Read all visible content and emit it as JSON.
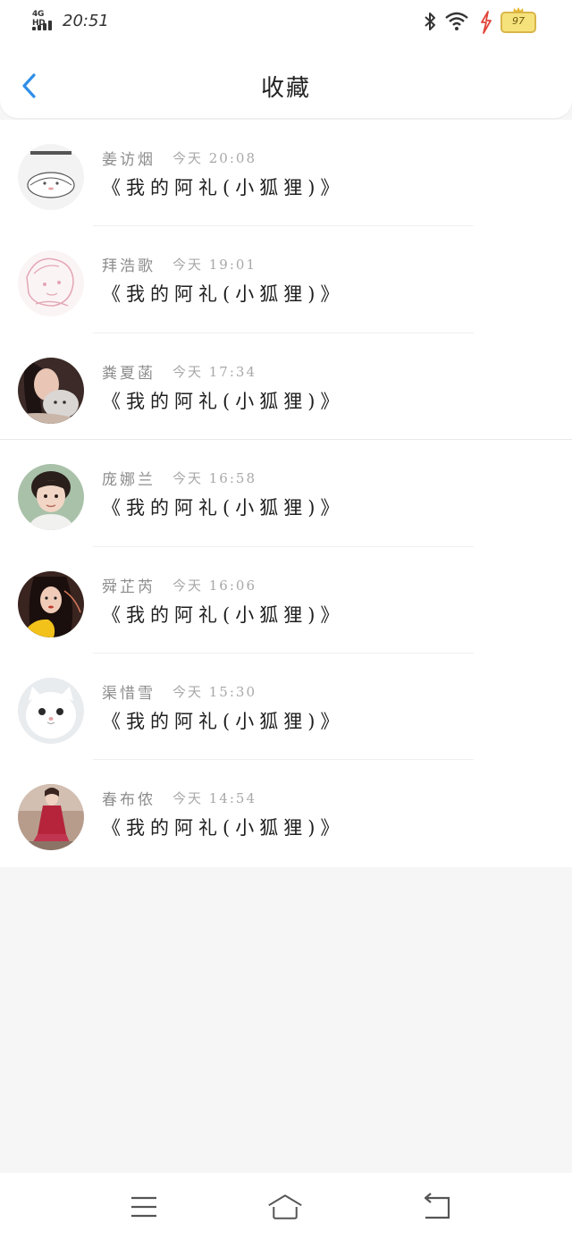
{
  "status_bar": {
    "network": "4G HD",
    "time": "20:51",
    "battery": "97",
    "icons": [
      "bluetooth-icon",
      "wifi-icon",
      "charging-icon",
      "battery-icon"
    ]
  },
  "header": {
    "title": "收藏",
    "back_icon": "chevron-left-icon",
    "accent_color": "#2f8fe8"
  },
  "favorites": [
    {
      "name": "姜访烟",
      "time": "今天 20:08",
      "song": "《我的阿礼(小狐狸)》",
      "avatar": "avatar-sticker"
    },
    {
      "name": "拜浩歌",
      "time": "今天 19:01",
      "song": "《我的阿礼(小狐狸)》",
      "avatar": "avatar-sketch"
    },
    {
      "name": "粪夏菡",
      "time": "今天 17:34",
      "song": "《我的阿礼(小狐狸)》",
      "avatar": "avatar-girl-cat"
    },
    {
      "name": "庞娜兰",
      "time": "今天 16:58",
      "song": "《我的阿礼(小狐狸)》",
      "avatar": "avatar-child"
    },
    {
      "name": "舜芷芮",
      "time": "今天 16:06",
      "song": "《我的阿礼(小狐狸)》",
      "avatar": "avatar-girl-yellow"
    },
    {
      "name": "渠惜雪",
      "time": "今天 15:30",
      "song": "《我的阿礼(小狐狸)》",
      "avatar": "avatar-white-cat"
    },
    {
      "name": "春布侬",
      "time": "今天 14:54",
      "song": "《我的阿礼(小狐狸)》",
      "avatar": "avatar-girl-red"
    }
  ],
  "nav_bar": {
    "icons": [
      "menu-icon",
      "home-icon",
      "back-icon"
    ]
  }
}
